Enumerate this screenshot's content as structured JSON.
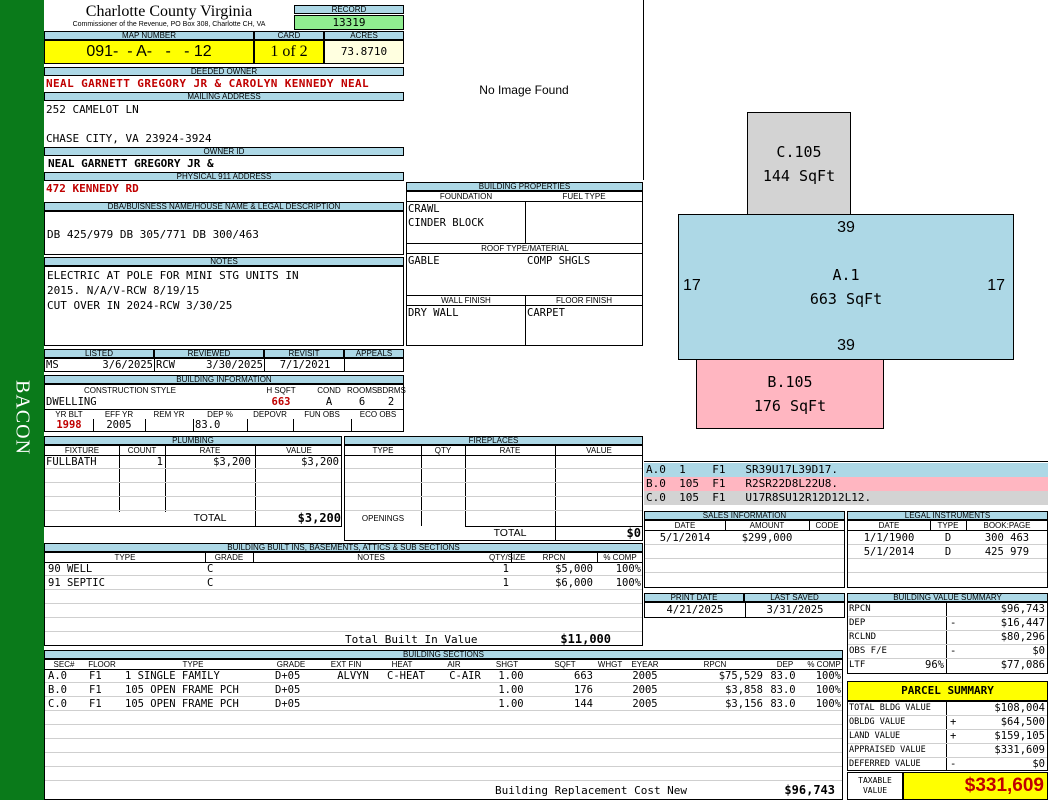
{
  "sidebar": {
    "label": "BACON"
  },
  "header": {
    "county": "Charlotte County Virginia",
    "commissioner": "Commissioner of the Revenue, PO Box 308, Charlotte CH, VA",
    "record_label": "RECORD",
    "record": "13319",
    "map_label": "MAP NUMBER",
    "map": "091-  - A-   -   - 12",
    "card_label": "CARD",
    "card": "1 of 2",
    "acres_label": "ACRES",
    "acres": "73.8710"
  },
  "owner": {
    "deeded_label": "DEEDED OWNER",
    "deeded": "NEAL GARNETT GREGORY JR & CAROLYN KENNEDY NEAL",
    "mailing_label": "MAILING ADDRESS",
    "addr1": "252 CAMELOT LN",
    "addr2": "CHASE CITY, VA 23924-3924",
    "owner_id_label": "OWNER ID",
    "owner_id": "NEAL GARNETT GREGORY JR &",
    "physical_label": "PHYSICAL 911 ADDRESS",
    "physical": "472 KENNEDY RD",
    "dba_label": "DBA/BUISNESS NAME/HOUSE NAME & LEGAL DESCRIPTION",
    "legal": "DB 425/979 DB 305/771 DB 300/463",
    "notes_label": "NOTES",
    "notes": [
      "ELECTRIC AT POLE FOR MINI STG UNITS IN",
      "2015. N/A/V-RCW 8/19/15",
      "CUT OVER IN 2024-RCW 3/30/25"
    ]
  },
  "review": {
    "labels": [
      "LISTED",
      "REVIEWED",
      "REVISIT",
      "APPEALS"
    ],
    "listed_by": "MS",
    "listed": "3/6/2025",
    "reviewed_by": "RCW",
    "reviewed": "3/30/2025",
    "revisit": "7/1/2021",
    "appeals": ""
  },
  "building_info": {
    "title": "BUILDING INFORMATION",
    "labels1": [
      "CONSTRUCTION STYLE",
      "H SQFT",
      "COND",
      "ROOMS",
      "BDRMS"
    ],
    "style": "DWELLING",
    "hsqft": "663",
    "cond": "A",
    "rooms": "6",
    "bdrms": "2",
    "labels2": [
      "YR BLT",
      "EFF YR",
      "REM YR",
      "DEP %",
      "DEPOVR",
      "FUN OBS",
      "ECO OBS"
    ],
    "yrblt": "1998",
    "effyr": "2005",
    "remyr": "",
    "dep": "83.0",
    "depovr": "",
    "funobs": "",
    "ecoobs": ""
  },
  "image": {
    "text": "No Image Found"
  },
  "properties": {
    "title": "BUILDING PROPERTIES",
    "foundation_label": "FOUNDATION",
    "fuel_label": "FUEL TYPE",
    "foundation": [
      "CRAWL",
      "CINDER BLOCK"
    ],
    "roof_label": "ROOF TYPE/MATERIAL",
    "roof_type": "GABLE",
    "roof_material": "COMP SHGLS",
    "wall_label": "WALL FINISH",
    "floor_label": "FLOOR FINISH",
    "wall": "DRY WALL",
    "floor": "CARPET"
  },
  "sketch": {
    "boxes": [
      {
        "id": "C.105",
        "area": "144 SqFt",
        "color": "#d3d3d3"
      },
      {
        "id": "A.1",
        "area": "663 SqFt",
        "color": "#add8e6"
      },
      {
        "id": "B.105",
        "area": "176 SqFt",
        "color": "#ffb6c1"
      }
    ],
    "dims": {
      "top": "39",
      "bottom": "39",
      "left": "17",
      "right": "17"
    }
  },
  "sketch_lines": [
    {
      "text": "A.0  1    F1   SR39U17L39D17.",
      "color": "#add8e6"
    },
    {
      "text": "B.0  105  F1   R2SR22D8L22U8.",
      "color": "#ffb6c1"
    },
    {
      "text": "C.0  105  F1   U17R8SU12R12D12L12.",
      "color": "#d3d3d3"
    }
  ],
  "plumbing": {
    "title": "PLUMBING",
    "headers": [
      "FIXTURE",
      "COUNT",
      "RATE",
      "VALUE"
    ],
    "rows": [
      [
        "FULLBATH",
        "1",
        "$3,200",
        "$3,200"
      ]
    ],
    "total_label": "TOTAL",
    "total": "$3,200"
  },
  "fireplaces": {
    "title": "FIREPLACES",
    "headers": [
      "TYPE",
      "QTY",
      "RATE",
      "VALUE"
    ],
    "openings_label": "OPENINGS",
    "total_label": "TOTAL",
    "total": "$0"
  },
  "sales": {
    "title": "SALES INFORMATION",
    "headers": [
      "DATE",
      "AMOUNT",
      "CODE"
    ],
    "rows": [
      [
        "5/1/2014",
        "$299,000",
        ""
      ]
    ]
  },
  "legal": {
    "title": "LEGAL INSTRUMENTS",
    "headers": [
      "DATE",
      "TYPE",
      "BOOK:PAGE"
    ],
    "rows": [
      [
        "1/1/1900",
        "D",
        "300 463"
      ],
      [
        "5/1/2014",
        "D",
        "425 979"
      ]
    ]
  },
  "print": {
    "print_label": "PRINT DATE",
    "saved_label": "LAST SAVED",
    "print_date": "4/21/2025",
    "saved_date": "3/31/2025"
  },
  "builtins": {
    "title": "BUILDING BUILT INS, BASEMENTS, ATTICS & SUB SECTIONS",
    "headers": [
      "TYPE",
      "GRADE",
      "NOTES",
      "QTY/SIZE",
      "RPCN",
      "% COMP"
    ],
    "rows": [
      [
        "90 WELL",
        "C",
        "",
        "1",
        "$5,000",
        "100%"
      ],
      [
        "91 SEPTIC",
        "C",
        "",
        "1",
        "$6,000",
        "100%"
      ]
    ],
    "total_label": "Total Built In Value",
    "total": "$11,000"
  },
  "value_summary": {
    "title": "BUILDING VALUE SUMMARY",
    "rows": [
      {
        "label": "RPCN",
        "sign": "",
        "pct": "",
        "value": "$96,743"
      },
      {
        "label": "DEP",
        "sign": "-",
        "pct": "",
        "value": "$16,447"
      },
      {
        "label": "RCLND",
        "sign": "",
        "pct": "",
        "value": "$80,296"
      },
      {
        "label": "OBS F/E",
        "sign": "-",
        "pct": "",
        "value": "$0"
      },
      {
        "label": "LTF",
        "sign": "",
        "pct": "96%",
        "value": "$77,086"
      }
    ]
  },
  "sections": {
    "title": "BUILDING SECTIONS",
    "headers": [
      "SEC#",
      "FLOOR",
      "TYPE",
      "GRADE",
      "EXT FIN",
      "HEAT",
      "AIR",
      "SHGT",
      "SQFT",
      "WHGT",
      "EYEAR",
      "RPCN",
      "DEP",
      "% COMP"
    ],
    "rows": [
      [
        "A.0",
        "F1",
        "1 SINGLE FAMILY",
        "D+05",
        "ALVYN",
        "C-HEAT",
        "C-AIR",
        "1.00",
        "663",
        "",
        "2005",
        "$75,529",
        "83.0",
        "100%"
      ],
      [
        "B.0",
        "F1",
        "105 OPEN FRAME PCH",
        "D+05",
        "",
        "",
        "",
        "1.00",
        "176",
        "",
        "2005",
        "$3,858",
        "83.0",
        "100%"
      ],
      [
        "C.0",
        "F1",
        "105 OPEN FRAME PCH",
        "D+05",
        "",
        "",
        "",
        "1.00",
        "144",
        "",
        "2005",
        "$3,156",
        "83.0",
        "100%"
      ]
    ],
    "rcn_label": "Building Replacement Cost New",
    "rcn": "$96,743"
  },
  "parcel": {
    "title": "PARCEL SUMMARY",
    "rows": [
      {
        "label": "TOTAL BLDG VALUE",
        "sign": "",
        "value": "$108,004"
      },
      {
        "label": "OBLDG VALUE",
        "sign": "+",
        "value": "$64,500"
      },
      {
        "label": "LAND VALUE",
        "sign": "+",
        "value": "$159,105"
      },
      {
        "label": "APPRAISED VALUE",
        "sign": "",
        "value": "$331,609"
      },
      {
        "label": "DEFERRED VALUE",
        "sign": "-",
        "value": "$0"
      }
    ],
    "taxable_label": "TAXABLE VALUE",
    "taxable": "$331,609"
  }
}
